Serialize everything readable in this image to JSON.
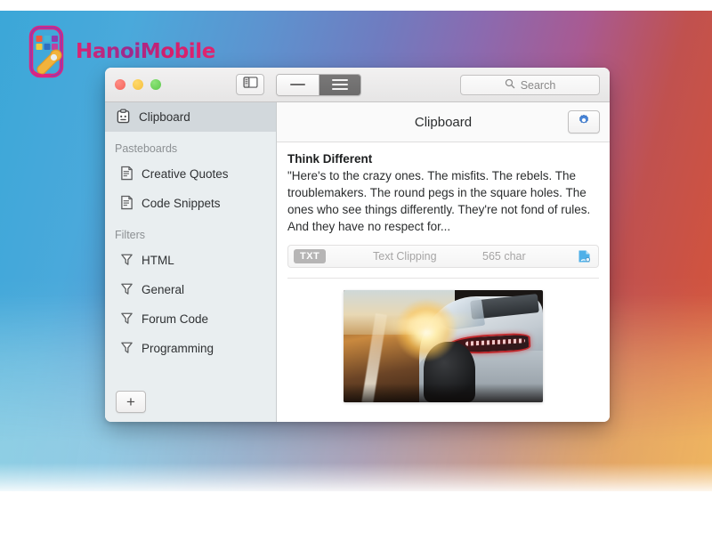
{
  "brand": {
    "name": "HanoiMobile",
    "mark_icon": "mobile-phone-wrench-icon",
    "colors": {
      "text_primary": "#e0246f",
      "text_secondary": "#9b2a8e",
      "phone": "#e0247f",
      "wrench": "#f2b33c"
    }
  },
  "background": {
    "gradient_top": [
      "#3ba7d8",
      "#6f7cc0",
      "#a85a92",
      "#d4583a"
    ],
    "gradient_bottom": [
      "#8fd0e4",
      "#b0aab6",
      "#f0b860"
    ]
  },
  "window": {
    "titlebar": {
      "traffic_lights": [
        {
          "name": "close",
          "color": "#f4635a"
        },
        {
          "name": "minimize",
          "color": "#f5bf3e"
        },
        {
          "name": "zoom",
          "color": "#5cc84a"
        }
      ],
      "sidebar_toggle": {
        "icon": "sidebar-toggle-icon",
        "label": "Toggle Sidebar"
      },
      "segmented_control": {
        "segments": [
          {
            "icon": "compact-view-icon",
            "label": "Compact",
            "selected": false
          },
          {
            "icon": "list-view-icon",
            "label": "List",
            "selected": true
          }
        ]
      },
      "search": {
        "icon": "search-icon",
        "placeholder": "Search",
        "value": ""
      }
    },
    "sidebar": {
      "primary": [
        {
          "icon": "clipboard-icon",
          "label": "Clipboard",
          "selected": true
        }
      ],
      "groups": [
        {
          "label": "Pasteboards",
          "items": [
            {
              "icon": "pasteboard-icon",
              "label": "Creative Quotes"
            },
            {
              "icon": "pasteboard-icon",
              "label": "Code Snippets"
            }
          ]
        },
        {
          "label": "Filters",
          "items": [
            {
              "icon": "filter-icon",
              "label": "HTML"
            },
            {
              "icon": "filter-icon",
              "label": "General"
            },
            {
              "icon": "filter-icon",
              "label": "Forum Code"
            },
            {
              "icon": "filter-icon",
              "label": "Programming"
            }
          ]
        }
      ],
      "footer": {
        "add_button_label": "+",
        "add_button_name": "add-pasteboard-button"
      }
    },
    "detail": {
      "title": "Clipboard",
      "settings_button": {
        "icon": "gear-icon",
        "color": "#3d7fd6"
      },
      "clips": [
        {
          "title": "Think Different",
          "text": "\"Here's to the crazy ones. The misfits. The rebels. The troublemakers. The round pegs in the square holes. The ones who see things differently. They're not fond of rules. And they have no respect for...",
          "meta": {
            "badge": "TXT",
            "kind": "Text Clipping",
            "count": "565 char",
            "icon": "text-clipping-file-icon"
          }
        },
        {
          "type": "image",
          "alt": "Silver sports car rear view on road at sunset"
        }
      ]
    }
  }
}
